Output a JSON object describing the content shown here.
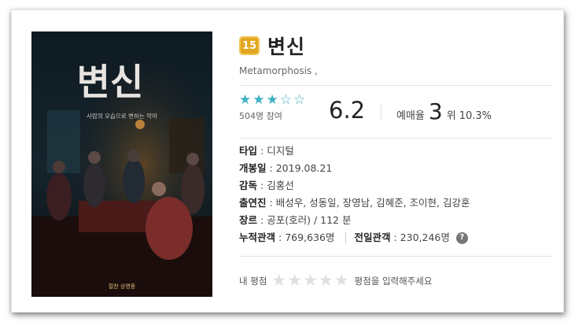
{
  "movie": {
    "age_rating": "15",
    "title": "변신",
    "subtitle": "Metamorphosis ,",
    "poster": {
      "title_text": "변신",
      "tagline": "사람의 모습으로 변하는 악마",
      "release_text": "절찬 상영중"
    }
  },
  "rating": {
    "stars_filled": 3,
    "stars_total": 5,
    "participants": "504명 참여",
    "score": "6.2"
  },
  "reservation": {
    "label": "예매율",
    "rank": "3",
    "rank_suffix": "위",
    "percent": "10.3%"
  },
  "details": {
    "type_label": "타입",
    "type_value": "디지털",
    "release_label": "개봉일",
    "release_value": "2019.08.21",
    "director_label": "감독",
    "director_value": "김홍선",
    "cast_label": "출연진",
    "cast_value": "배성우, 성동일, 장영남, 김혜준, 조이현, 김강훈",
    "genre_label": "장르",
    "genre_value": "공포(호러) / 112 분",
    "cumulative_label": "누적관객",
    "cumulative_value": "769,636명",
    "previous_day_label": "전일관객",
    "previous_day_value": "230,246명",
    "help_icon_text": "?"
  },
  "my_rating": {
    "label": "내 평점",
    "hint": "평점을 입력해주세요"
  },
  "colors": {
    "star_accent": "#3fb0c2",
    "badge": "#e2a61f"
  }
}
